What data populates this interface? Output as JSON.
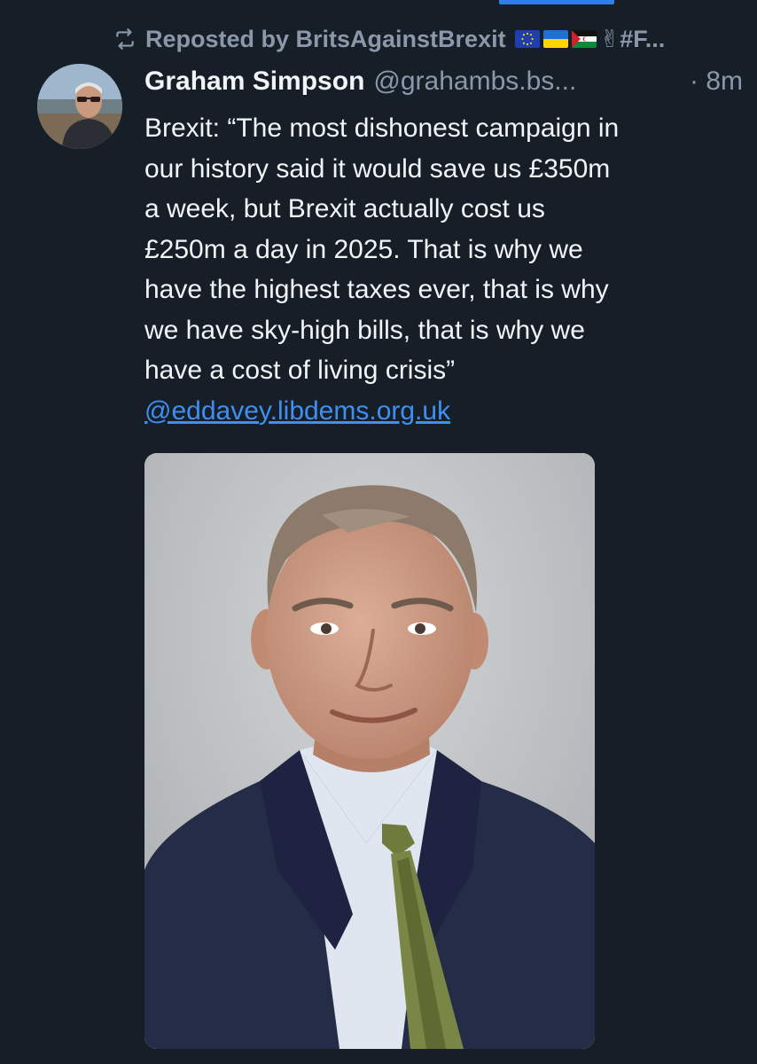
{
  "repost": {
    "prefix": "Reposted by BritsAgainstBrexit",
    "suffix": "✌#F..."
  },
  "post": {
    "author_name": "Graham Simpson",
    "author_handle": "@grahambs.bs...",
    "time": "· 8m",
    "text_lines": [
      "Brexit: “The most dishonest campaign in",
      "our history said it would save us £350m",
      "a week, but Brexit actually cost us",
      "£250m a day in 2025. That is why we",
      "have the highest taxes ever, that is why",
      "we have sky-high bills, that is why we",
      "have a cost of living crisis”"
    ],
    "mention": "@eddavey.libdems.org.uk"
  },
  "colors": {
    "background": "#161e27",
    "link": "#3f8ff2",
    "muted": "#8a98a9",
    "text": "#f2f5f8",
    "accent": "#2f7fe6"
  },
  "icons": {
    "repost": "repost-icon",
    "flags": [
      "eu-flag",
      "ukraine-flag",
      "western-sahara-flag"
    ]
  }
}
